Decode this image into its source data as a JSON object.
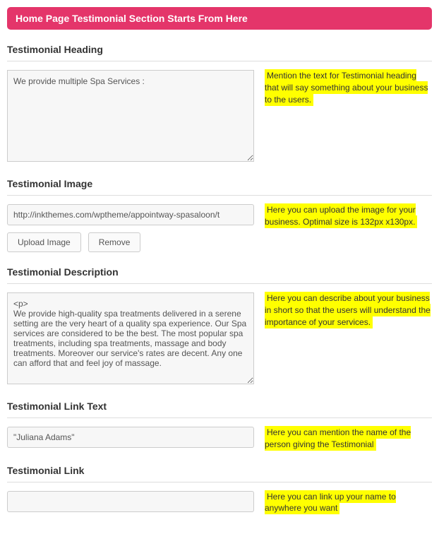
{
  "header": {
    "title": "Home Page Testimonial Section Starts From Here"
  },
  "fields": {
    "heading": {
      "label": "Testimonial Heading",
      "value": "We provide multiple Spa Services :",
      "help": "Mention the text for Testimonial heading that will say something about your business to the users."
    },
    "image": {
      "label": "Testimonial Image",
      "value": "http://inkthemes.com/wptheme/appointway-spasaloon/t",
      "help": "Here you can upload the image for your business. Optimal size is 132px x130px.",
      "upload_btn": "Upload Image",
      "remove_btn": "Remove"
    },
    "description": {
      "label": "Testimonial Description",
      "value": "<p>\nWe provide high-quality spa treatments delivered in a serene setting are the very heart of a quality spa experience. Our Spa services are considered to be the best. The most popular spa treatments, including spa treatments, massage and body treatments. Moreover our service's rates are decent. Any one can afford that and feel joy of massage.",
      "help": "Here you can describe about your business in short so that the users will understand the importance of your services."
    },
    "link_text": {
      "label": "Testimonial Link Text",
      "value": "\"Juliana Adams\"",
      "help": "Here you can mention the name of the person giving the Testimonial"
    },
    "link": {
      "label": "Testimonial Link",
      "value": "",
      "help": "Here you can link up your name to anywhere you want"
    }
  }
}
